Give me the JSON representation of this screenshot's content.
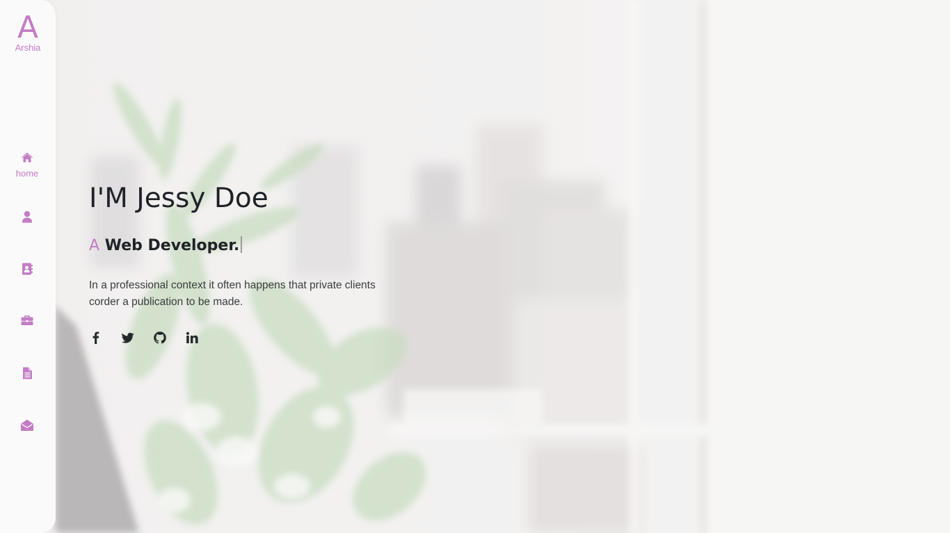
{
  "brand": {
    "logo_letter": "A",
    "name": "Arshia",
    "accent_color": "#c27dc4"
  },
  "nav": {
    "items": [
      {
        "id": "home",
        "icon": "home-icon",
        "label": "home",
        "active": true
      },
      {
        "id": "about",
        "icon": "user-icon",
        "label": ""
      },
      {
        "id": "contact-book",
        "icon": "address-book-icon",
        "label": ""
      },
      {
        "id": "portfolio",
        "icon": "briefcase-icon",
        "label": ""
      },
      {
        "id": "resume",
        "icon": "document-icon",
        "label": ""
      },
      {
        "id": "contact",
        "icon": "envelope-open-icon",
        "label": ""
      }
    ]
  },
  "hero": {
    "title": "I'M Jessy Doe",
    "role_prefix": "A",
    "role": "Web Developer.",
    "description": "In a professional context it often happens that private clients corder a publication to be made."
  },
  "social": [
    {
      "icon": "facebook-icon"
    },
    {
      "icon": "twitter-icon"
    },
    {
      "icon": "github-icon"
    },
    {
      "icon": "linkedin-icon"
    }
  ]
}
